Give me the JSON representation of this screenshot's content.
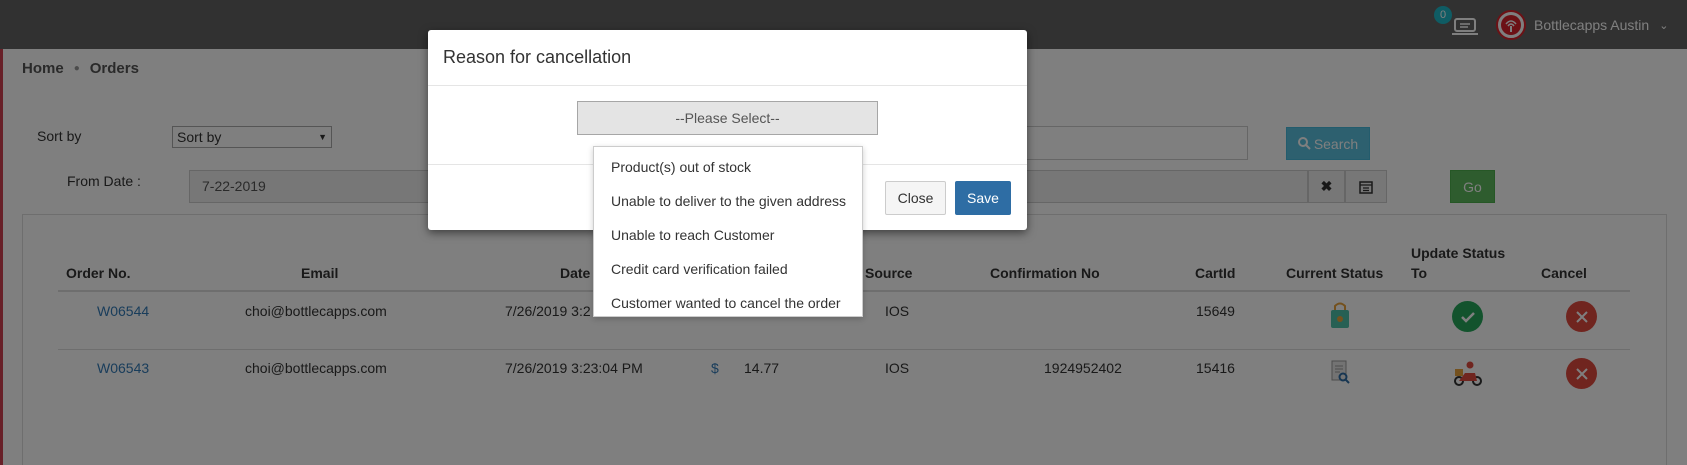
{
  "header": {
    "notification_count": "0",
    "user_name": "Bottlecapps Austin"
  },
  "breadcrumb": {
    "home": "Home",
    "current": "Orders"
  },
  "filters": {
    "sort_label": "Sort by",
    "sort_value": "Sort by",
    "search_button": "Search",
    "from_date_label": "From Date :",
    "from_date_value": "7-22-2019",
    "go_button": "Go"
  },
  "table": {
    "headers": {
      "order_no": "Order No.",
      "email": "Email",
      "date": "Date",
      "source": "Source",
      "confirmation": "Confirmation No",
      "cartid": "CartId",
      "current_status": "Current Status",
      "update_status_line1": "Update Status",
      "update_status_line2": "To",
      "cancel": "Cancel"
    },
    "rows": [
      {
        "order_no": "W06544",
        "email": "choi@bottlecapps.com",
        "date": "7/26/2019 3:2",
        "currency": "",
        "amount": "",
        "source": "IOS",
        "confirmation": "",
        "cartid": "15649"
      },
      {
        "order_no": "W06543",
        "email": "choi@bottlecapps.com",
        "date": "7/26/2019 3:23:04 PM",
        "currency": "$",
        "amount": "14.77",
        "source": "IOS",
        "confirmation": "1924952402",
        "cartid": "15416"
      }
    ]
  },
  "modal": {
    "title": "Reason for cancellation",
    "select_placeholder": "--Please Select--",
    "close_button": "Close",
    "save_button": "Save",
    "options": [
      "Product(s) out of stock",
      "Unable to deliver to the given address",
      "Unable to reach Customer",
      "Credit card verification failed",
      "Customer wanted to cancel the order"
    ]
  },
  "colors": {
    "topbar": "#636363",
    "search_button": "#5bc0de",
    "go_button": "#5cb85c",
    "save_button": "#2e6da4",
    "status_ok": "#26a65b",
    "cancel_red": "#e04a3f"
  }
}
